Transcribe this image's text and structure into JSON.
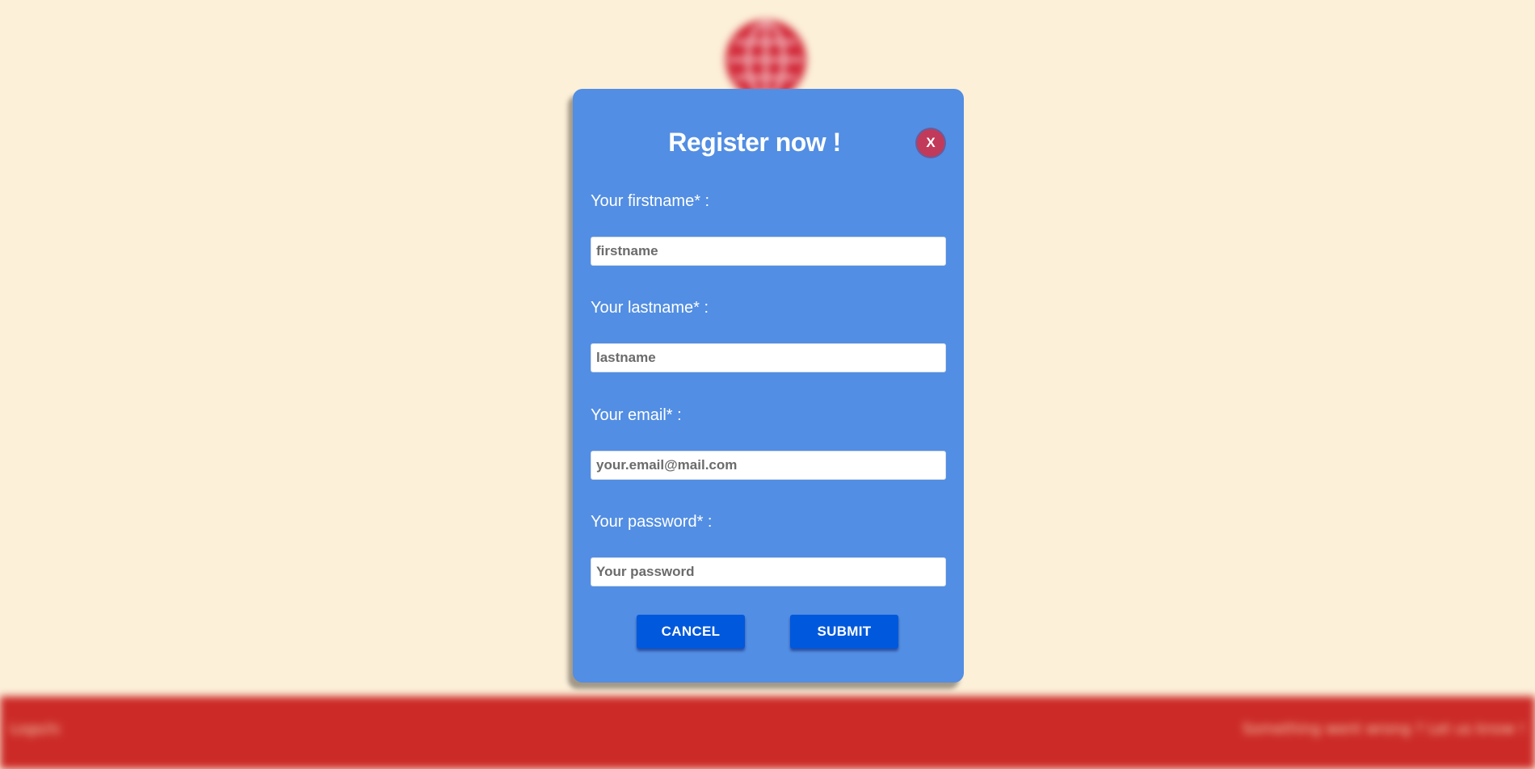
{
  "background": {
    "footer": {
      "left_text": "Logo/ic",
      "right_text": "Something went wrong ? Let us know !"
    },
    "logo_icon": "globe-icon"
  },
  "modal": {
    "title": "Register now !",
    "close_label": "X",
    "fields": [
      {
        "label": "Your firstname* :",
        "placeholder": "firstname",
        "type": "text"
      },
      {
        "label": "Your lastname* :",
        "placeholder": "lastname",
        "type": "text"
      },
      {
        "label": "Your email* :",
        "placeholder": "your.email@mail.com",
        "type": "email"
      },
      {
        "label": "Your password* :",
        "placeholder": "Your password",
        "type": "password"
      }
    ],
    "cancel_label": "CANCEL",
    "submit_label": "SUBMIT"
  },
  "colors": {
    "page_background": "#fcf0d9",
    "modal_background": "#528ee3",
    "button_primary": "#0058dc",
    "close_button": "#c23a5a",
    "footer_background": "#cc2a27"
  }
}
